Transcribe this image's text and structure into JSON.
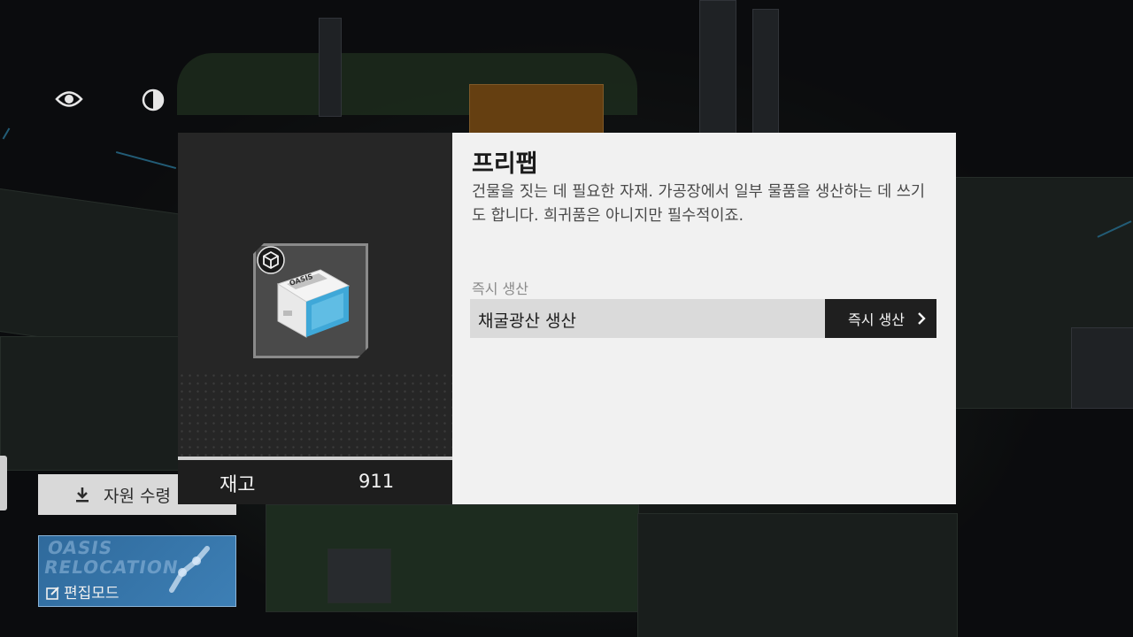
{
  "hud": {
    "eye_icon": "eye-icon",
    "contrast_icon": "contrast-icon"
  },
  "bottom_hud": {
    "resource_button_label": "자원 수령",
    "edit_card_bg_text": "OASIS RELOCATION",
    "edit_mode_label": "편집모드"
  },
  "item": {
    "name": "프리팹",
    "description": "건물을 짓는 데 필요한 자재. 가공장에서 일부 물품을 생산하는 데 쓰기도 합니다. 희귀품은 아니지만 필수적이죠.",
    "stock_label": "재고",
    "stock_value": "911",
    "package_text": "OASIS"
  },
  "production": {
    "section_label": "즉시 생산",
    "rows": [
      {
        "name": "채굴광산 생산",
        "button_label": "즉시 생산"
      }
    ]
  },
  "colors": {
    "panel_light": "#f1f1f1",
    "panel_dark": "#262626",
    "button_dark": "#1f1f1f",
    "accent_blue": "#3fa8d8"
  }
}
